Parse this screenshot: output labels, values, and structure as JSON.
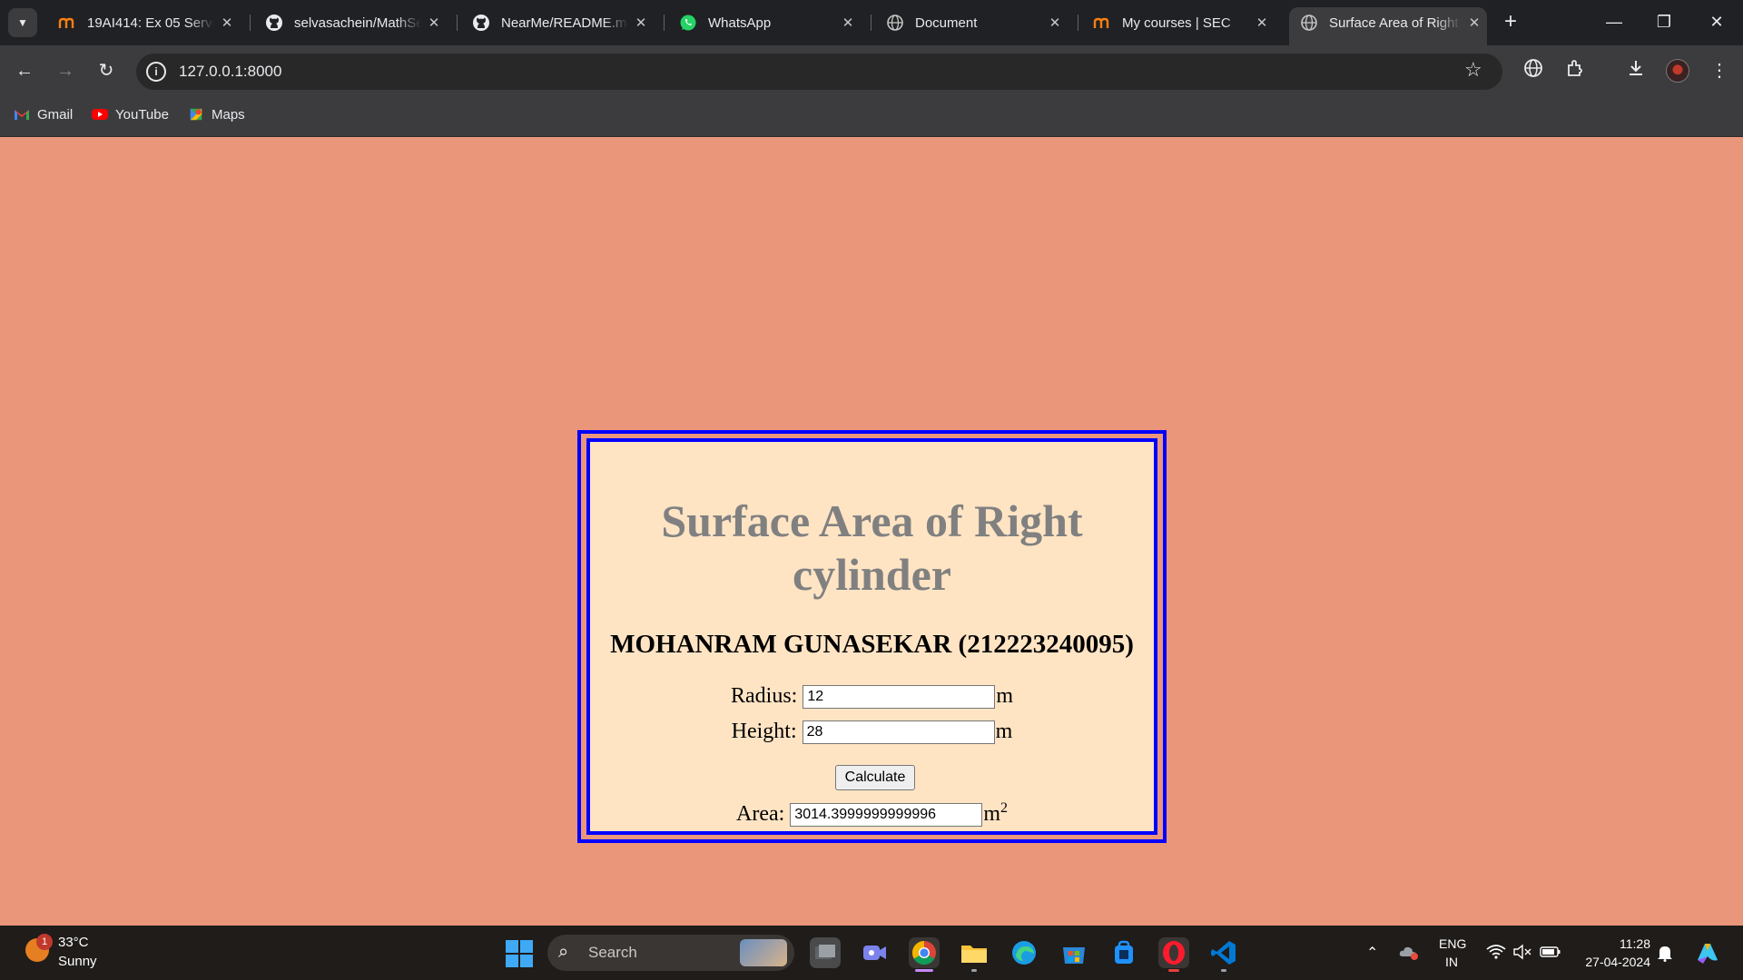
{
  "browser": {
    "tabs": [
      {
        "title": "19AI414: Ex 05 Server",
        "icon": "moodle-icon"
      },
      {
        "title": "selvasachein/MathServer",
        "icon": "github-icon"
      },
      {
        "title": "NearMe/README.md",
        "icon": "github-icon"
      },
      {
        "title": "WhatsApp",
        "icon": "whatsapp-icon"
      },
      {
        "title": "Document",
        "icon": "globe-icon"
      },
      {
        "title": "My courses | SEC",
        "icon": "moodle-icon"
      },
      {
        "title": "Surface Area of Right",
        "icon": "globe-icon"
      }
    ],
    "url": "127.0.0.1:8000",
    "bookmarks": [
      "Gmail",
      "YouTube",
      "Maps"
    ]
  },
  "page": {
    "title": "Surface Area of Right cylinder",
    "author": "MOHANRAM GUNASEKAR (212223240095)",
    "radius_label": "Radius:",
    "radius_value": "12",
    "radius_unit": "m",
    "height_label": "Height:",
    "height_value": "28",
    "height_unit": "m",
    "calculate_label": "Calculate",
    "area_label": "Area:",
    "area_value": "3014.3999999999996",
    "area_unit": "m",
    "area_unit_sup": "2",
    "border_color": "#0000ff",
    "box_background": "#ffe4c4",
    "page_background": "#e9967a"
  },
  "taskbar": {
    "weather_badge": "1",
    "temperature": "33°C",
    "condition": "Sunny",
    "search_label": "Search",
    "lang_line1": "ENG",
    "lang_line2": "IN",
    "time": "11:28",
    "date": "27-04-2024"
  }
}
